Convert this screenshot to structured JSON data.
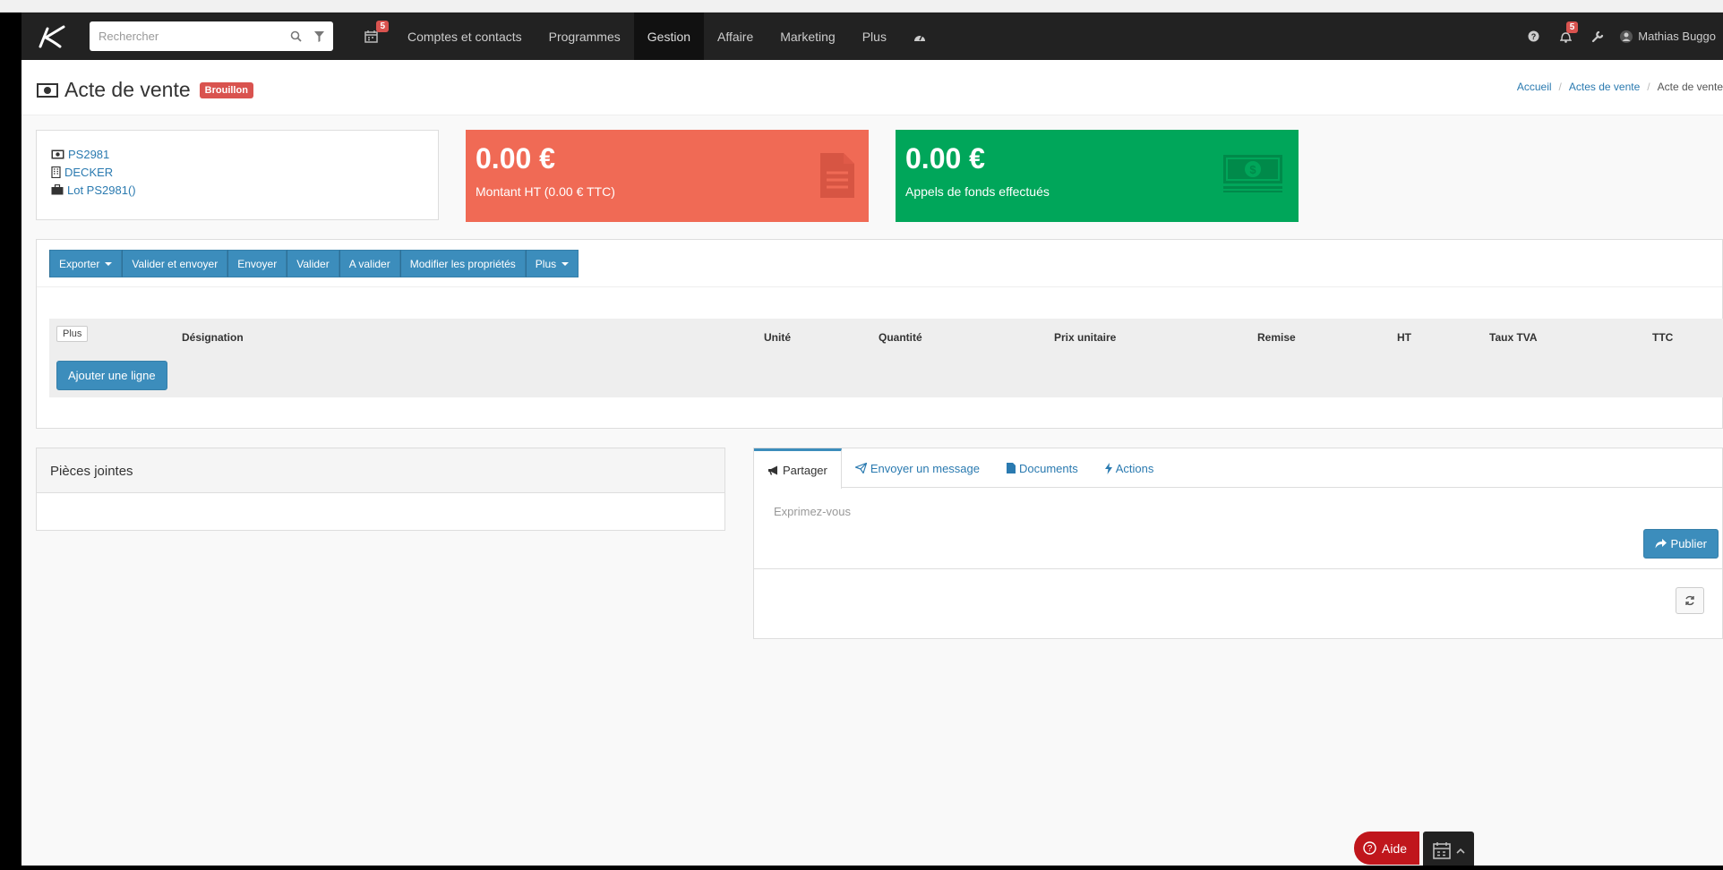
{
  "navbar": {
    "search_placeholder": "Rechercher",
    "calendar_badge": "5",
    "links": [
      "Comptes et contacts",
      "Programmes",
      "Gestion",
      "Affaire",
      "Marketing",
      "Plus"
    ],
    "active_link": "Gestion",
    "notifications_badge": "5",
    "user_name": "Mathias Buggo"
  },
  "page": {
    "title": "Acte de vente",
    "status": "Brouillon",
    "breadcrumb": [
      "Accueil",
      "Actes de vente",
      "Acte de vente"
    ]
  },
  "info": {
    "reference": "PS2981",
    "client": "DECKER",
    "lot": "Lot PS2981()"
  },
  "stats": {
    "amount": {
      "value": "0.00 €",
      "label": "Montant HT (0.00 € TTC)",
      "color": "#f06a55"
    },
    "funds": {
      "value": "0.00 €",
      "label": "Appels de fonds effectués",
      "color": "#00a65a"
    }
  },
  "toolbar": {
    "export": "Exporter",
    "validate_send": "Valider et envoyer",
    "send": "Envoyer",
    "validate": "Valider",
    "to_validate": "A valider",
    "edit_props": "Modifier les propriétés",
    "more": "Plus"
  },
  "table": {
    "plus": "Plus",
    "headers": [
      "Désignation",
      "Unité",
      "Quantité",
      "Prix unitaire",
      "Remise",
      "HT",
      "Taux TVA",
      "TTC"
    ],
    "add_line": "Ajouter une ligne"
  },
  "attachments": {
    "title": "Pièces jointes"
  },
  "social": {
    "tabs": [
      "Partager",
      "Envoyer un message",
      "Documents",
      "Actions"
    ],
    "placeholder": "Exprimez-vous",
    "publish": "Publier"
  },
  "widgets": {
    "help": "Aide"
  },
  "colors": {
    "primary": "#3c8dbc",
    "danger": "#d9534f",
    "navbar": "#222222"
  }
}
